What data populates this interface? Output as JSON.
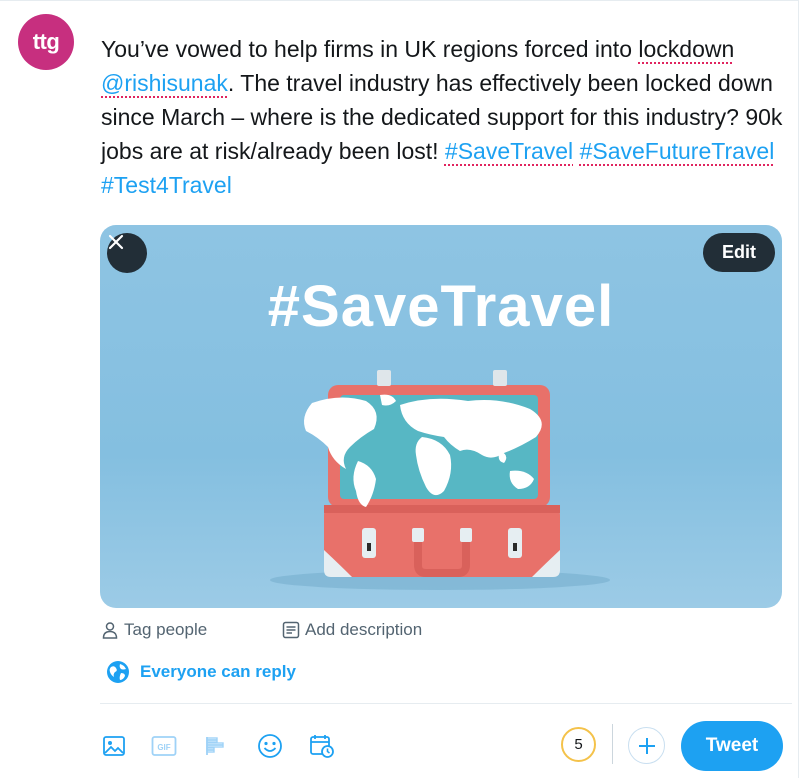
{
  "account": {
    "avatar_text": "ttg",
    "avatar_color": "#c72f7f"
  },
  "tweet": {
    "part1": "You’ve vowed to help firms in UK regions forced into ",
    "spell_word": "lockdown",
    "space1": " ",
    "mention": "@rishisunak",
    "part2": ". The travel industry has effectively been locked down since March – where is the dedicated support for this industry? 90k jobs are at risk/already been lost! ",
    "hashtags": [
      "#SaveTravel",
      "#SaveFutureTravel",
      "#Test4Travel"
    ]
  },
  "media": {
    "edit_label": "Edit",
    "image_text": "#SaveTravel",
    "close_icon": "close-icon"
  },
  "media_actions": {
    "tag_people": "Tag people",
    "add_description": "Add description"
  },
  "reply_setting": {
    "label": "Everyone can reply",
    "icon": "globe-icon"
  },
  "toolbar": {
    "icons": [
      "image-icon",
      "gif-icon",
      "poll-icon",
      "emoji-icon",
      "schedule-icon"
    ],
    "gif_label": "GIF",
    "remaining_count": "5",
    "tweet_label": "Tweet"
  },
  "colors": {
    "accent": "#1da1f2",
    "counter_warning": "#f4c24a",
    "spell_error": "#e0245e"
  }
}
